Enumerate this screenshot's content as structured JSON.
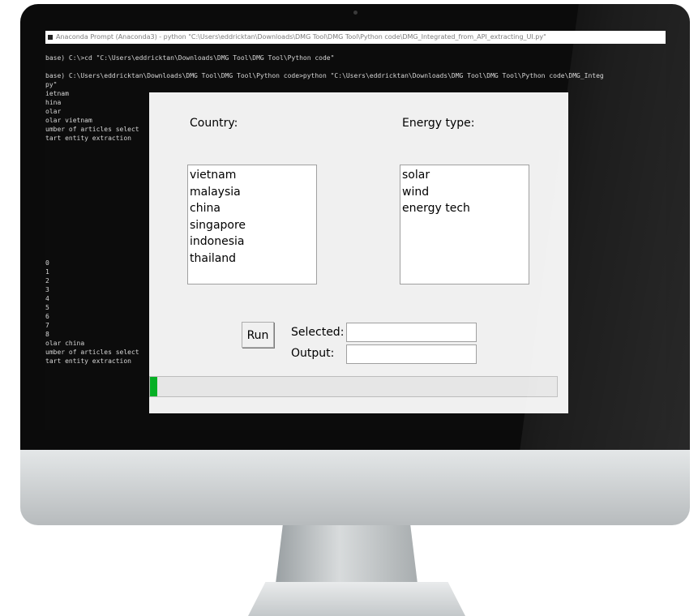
{
  "window": {
    "title": "Anaconda Prompt (Anaconda3) - python  \"C:\\Users\\eddricktan\\Downloads\\DMG Tool\\DMG Tool\\Python code\\DMG_Integrated_from_API_extracting_UI.py\""
  },
  "console": {
    "lines": [
      "base) C:\\>cd \"C:\\Users\\eddricktan\\Downloads\\DMG Tool\\DMG Tool\\Python code\"",
      "",
      "base) C:\\Users\\eddricktan\\Downloads\\DMG Tool\\DMG Tool\\Python code>python \"C:\\Users\\eddricktan\\Downloads\\DMG Tool\\DMG Tool\\Python code\\DMG_Integ",
      "py\"",
      "ietnam",
      "hina",
      "olar",
      "olar vietnam",
      "umber of articles select",
      "tart entity extraction",
      "",
      "",
      "",
      "",
      "",
      "",
      "",
      "",
      "",
      "",
      "",
      "",
      "",
      "0",
      "1",
      "2",
      "3",
      "4",
      "5",
      "6",
      "7",
      "8",
      "olar china",
      "umber of articles select",
      "tart entity extraction"
    ]
  },
  "dialog": {
    "country_label": "Country:",
    "energy_label": "Energy type:",
    "countries": [
      "vietnam",
      "malaysia",
      "china",
      "singapore",
      "indonesia",
      "thailand"
    ],
    "energy_types": [
      "solar",
      "wind",
      "energy tech"
    ],
    "run_label": "Run",
    "selected_label": "Selected:",
    "output_label": "Output:",
    "selected_value": "",
    "output_value": "",
    "progress": 0.017
  },
  "colors": {
    "console_bg": "#0c0c0c",
    "console_text": "#d6d6d6",
    "dialog_bg": "#f0f0f0",
    "progress_fill": "#06b025"
  }
}
